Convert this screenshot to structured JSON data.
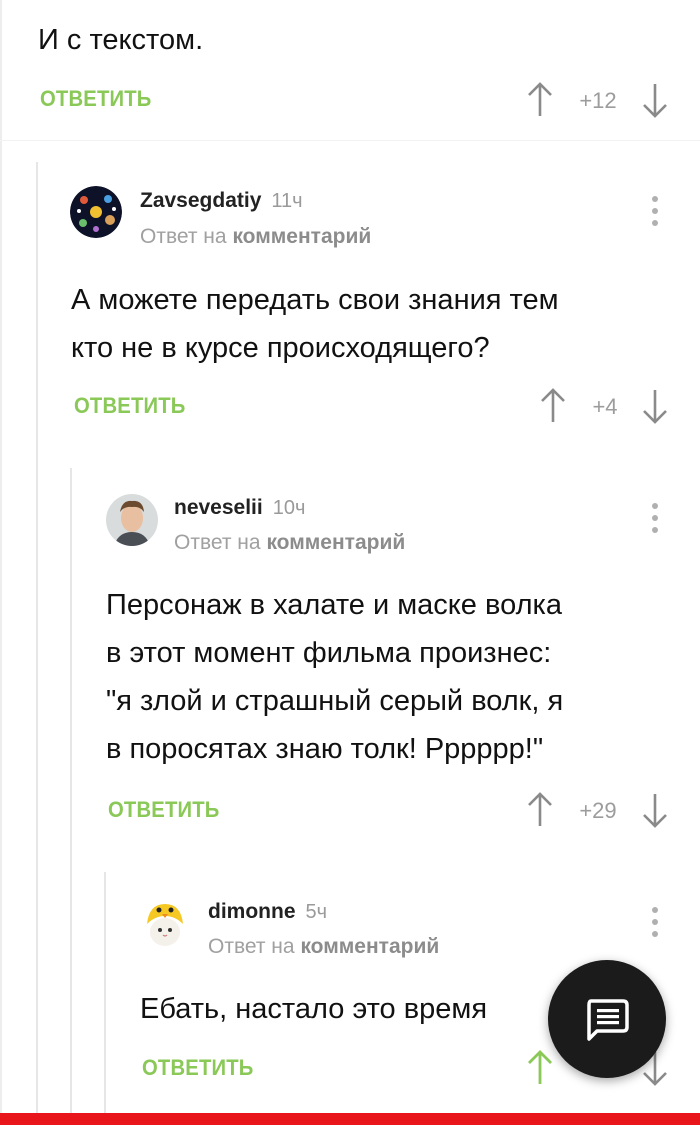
{
  "top_comment": {
    "text": "И с текстом.",
    "reply_label": "ОТВЕТИТЬ",
    "score": "+12"
  },
  "comments": [
    {
      "username": "Zavsegdatiy",
      "time": "11ч",
      "reply_to_prefix": "Ответ на",
      "reply_to_target": "комментарий",
      "text_lines": [
        "А можете передать свои знания тем",
        "кто не в курсе происходящего?"
      ],
      "reply_label": "ОТВЕТИТЬ",
      "score": "+4"
    },
    {
      "username": "neveselii",
      "time": "10ч",
      "reply_to_prefix": "Ответ на",
      "reply_to_target": "комментарий",
      "text_lines": [
        "Персонаж в халате и маске волка",
        "в этот момент фильма произнес:",
        "\"я злой и страшный серый волк, я",
        "в поросятах знаю толк! Рррррр!\""
      ],
      "reply_label": "ОТВЕТИТЬ",
      "score": "+29"
    },
    {
      "username": "dimonne",
      "time": "5ч",
      "reply_to_prefix": "Ответ на",
      "reply_to_target": "комментарий",
      "text_lines": [
        "Ебать, настало это время"
      ],
      "reply_label": "ОТВЕТИТЬ",
      "score": ""
    }
  ],
  "colors": {
    "accent_green": "#8ac858",
    "fab_background": "#1b1b1b",
    "bottom_bar": "#e8161b"
  },
  "icons": {
    "upvote": "arrow-up-icon",
    "downvote": "arrow-down-icon",
    "menu": "more-vertical-icon",
    "fab": "comment-icon"
  }
}
